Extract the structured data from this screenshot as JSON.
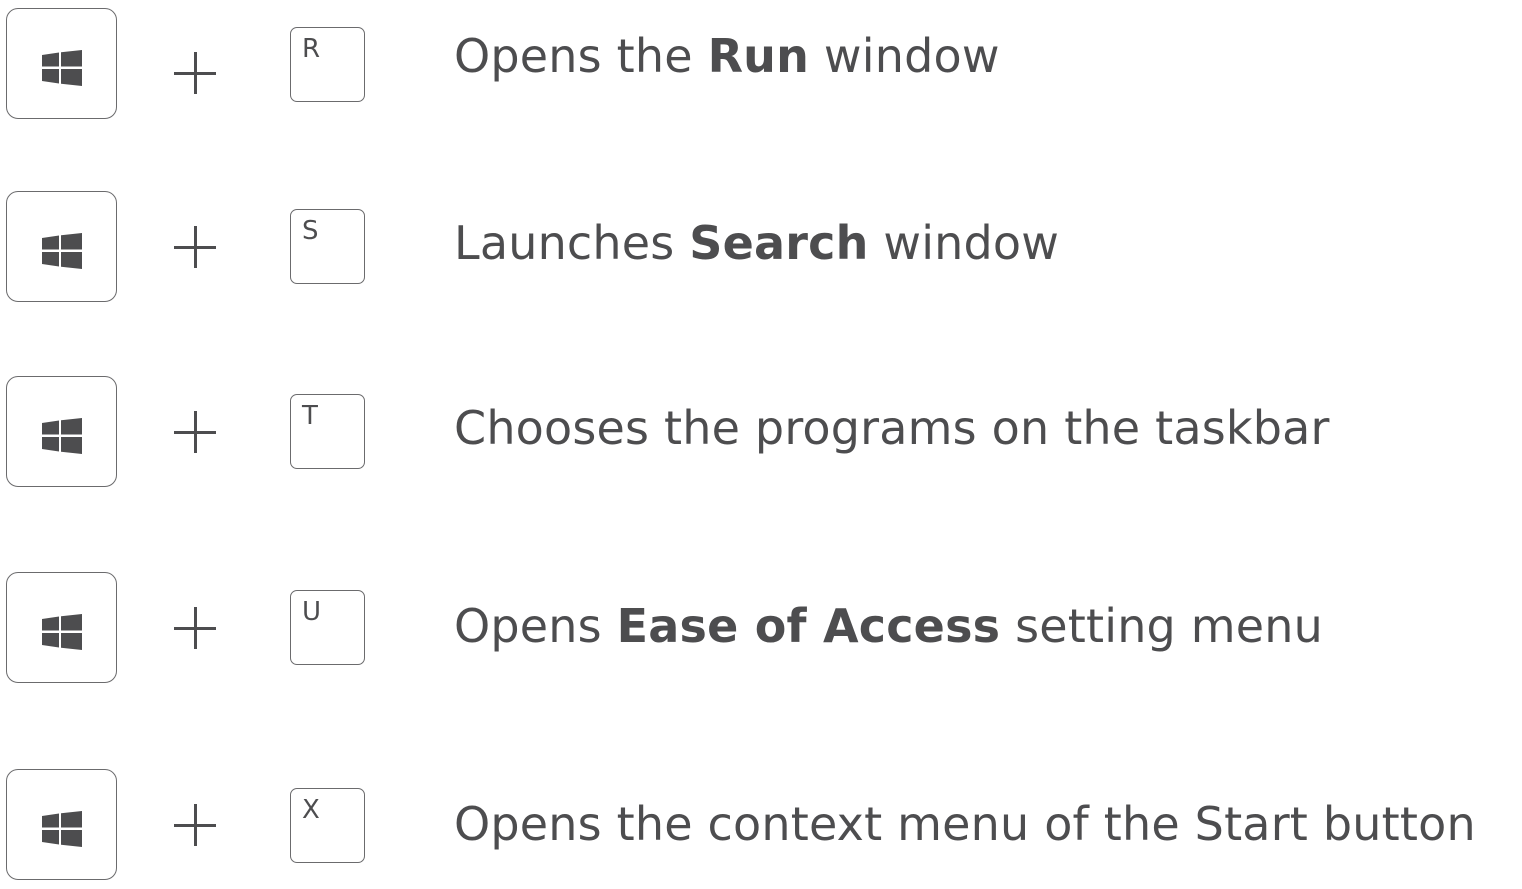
{
  "colors": {
    "text": "#4d4d4f",
    "key_border": "#6b6b6d",
    "background": "#ffffff"
  },
  "modifier_icon": "windows-logo-icon",
  "plus_sign": "+",
  "shortcuts": [
    {
      "key": "R",
      "before": "Opens the ",
      "bold": "Run",
      "after": " window"
    },
    {
      "key": "S",
      "before": "Launches ",
      "bold": "Search",
      "after": " window"
    },
    {
      "key": "T",
      "before": "Chooses the programs on the taskbar",
      "bold": "",
      "after": ""
    },
    {
      "key": "U",
      "before": "Opens ",
      "bold": "Ease of Access",
      "after": " setting menu"
    },
    {
      "key": "X",
      "before": "Opens the context menu of the Start button",
      "bold": "",
      "after": ""
    }
  ]
}
